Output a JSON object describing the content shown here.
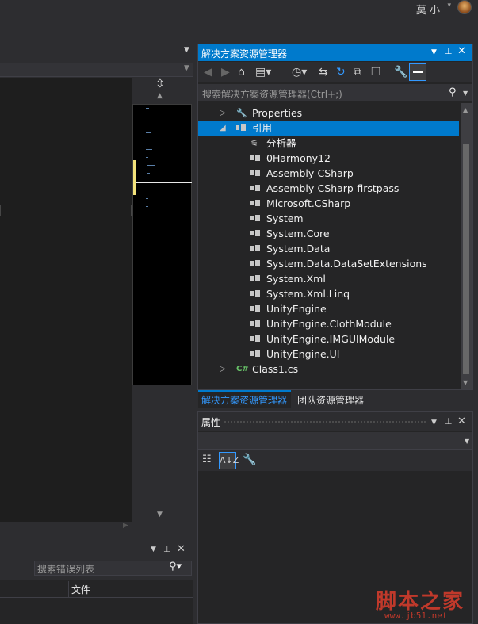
{
  "user": {
    "name": "莫 小",
    "caret": "▾"
  },
  "editor": {
    "split_glyph": "⇳"
  },
  "error_list": {
    "search_placeholder": "搜索错误列表",
    "column_file": "文件",
    "pin": "📌",
    "close": "✕"
  },
  "solution_explorer": {
    "title": "解决方案资源管理器",
    "search_placeholder": "搜索解决方案资源管理器(Ctrl+;)",
    "tree": [
      {
        "label": "Properties",
        "icon": "wrench-icon",
        "indent": 1,
        "expander": "collapsed"
      },
      {
        "label": "引用",
        "icon": "reference-icon",
        "indent": 1,
        "expander": "expanded",
        "selected": true
      },
      {
        "label": "分析器",
        "icon": "analyzer-icon",
        "indent": 2
      },
      {
        "label": "0Harmony12",
        "icon": "reference-icon",
        "indent": 2
      },
      {
        "label": "Assembly-CSharp",
        "icon": "reference-icon",
        "indent": 2
      },
      {
        "label": "Assembly-CSharp-firstpass",
        "icon": "reference-icon",
        "indent": 2
      },
      {
        "label": "Microsoft.CSharp",
        "icon": "reference-icon",
        "indent": 2
      },
      {
        "label": "System",
        "icon": "reference-icon",
        "indent": 2
      },
      {
        "label": "System.Core",
        "icon": "reference-icon",
        "indent": 2
      },
      {
        "label": "System.Data",
        "icon": "reference-icon",
        "indent": 2
      },
      {
        "label": "System.Data.DataSetExtensions",
        "icon": "reference-icon",
        "indent": 2
      },
      {
        "label": "System.Xml",
        "icon": "reference-icon",
        "indent": 2
      },
      {
        "label": "System.Xml.Linq",
        "icon": "reference-icon",
        "indent": 2
      },
      {
        "label": "UnityEngine",
        "icon": "reference-icon",
        "indent": 2
      },
      {
        "label": "UnityEngine.ClothModule",
        "icon": "reference-icon",
        "indent": 2
      },
      {
        "label": "UnityEngine.IMGUIModule",
        "icon": "reference-icon",
        "indent": 2
      },
      {
        "label": "UnityEngine.UI",
        "icon": "reference-icon",
        "indent": 2
      },
      {
        "label": "Class1.cs",
        "icon": "csharp-file-icon",
        "indent": 1,
        "expander": "collapsed"
      }
    ],
    "tabs": {
      "solution": "解决方案资源管理器",
      "team": "团队资源管理器"
    }
  },
  "properties": {
    "title": "属性",
    "alpha_sort_label": "A↓Z"
  },
  "watermark": {
    "logo": "脚本之家",
    "url": "www.jb51.net"
  },
  "colors": {
    "accent": "#007acc",
    "background": "#2d2d30",
    "panel": "#252526",
    "editor": "#1e1e1e"
  }
}
